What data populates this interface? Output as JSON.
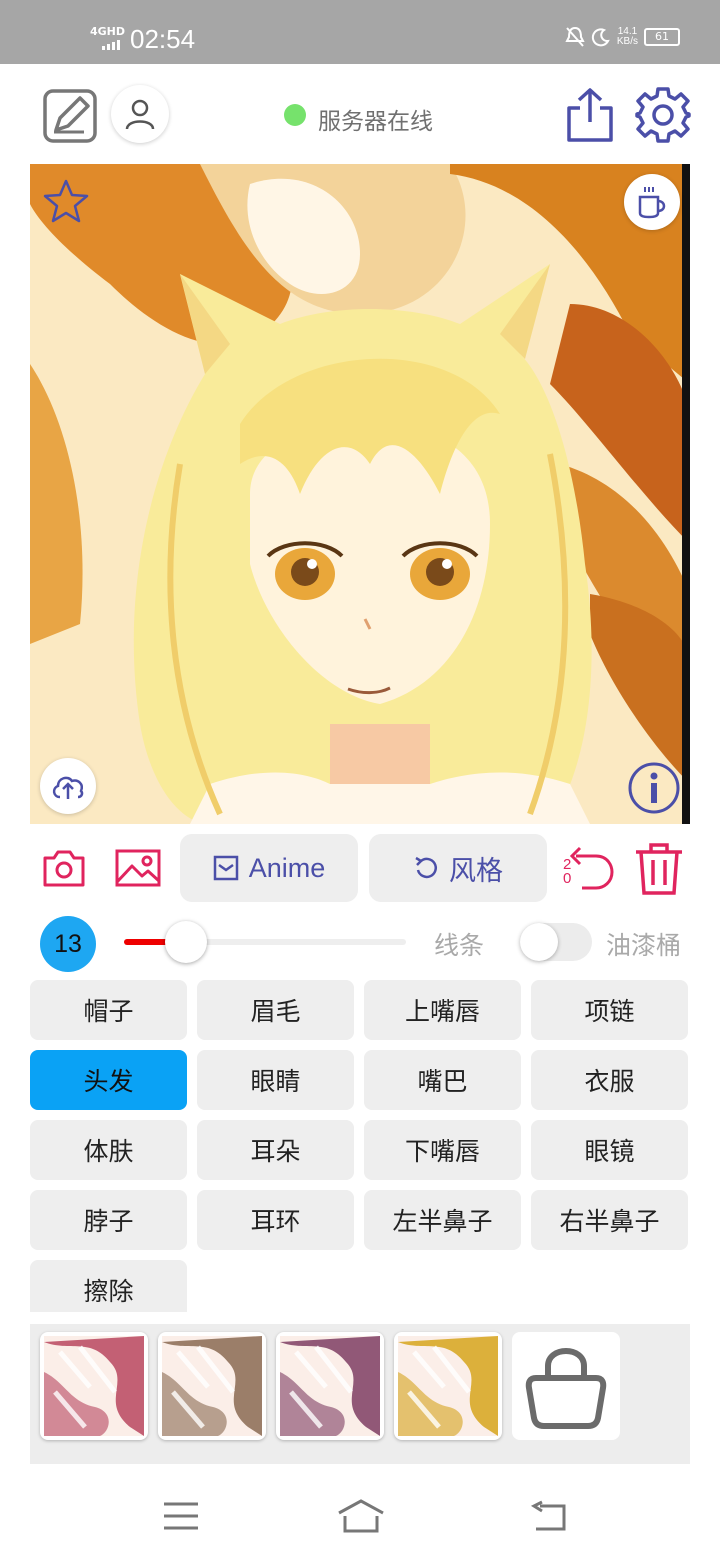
{
  "status_bar": {
    "network": "4GHD",
    "time": "02:54",
    "speed_value": "14.1",
    "speed_unit": "KB/s",
    "battery": "61"
  },
  "header": {
    "server_status": "服务器在线",
    "status_color": "#76e26c"
  },
  "tools": {
    "model_label": "Anime",
    "style_label": "风格",
    "undo_count_top": "2",
    "undo_count_bottom": "0"
  },
  "brush": {
    "size": "13",
    "size_fraction": 0.22,
    "line_label": "线条",
    "bucket_label": "油漆桶",
    "bucket_enabled": false
  },
  "parts": [
    {
      "label": "帽子",
      "active": false
    },
    {
      "label": "眉毛",
      "active": false
    },
    {
      "label": "上嘴唇",
      "active": false
    },
    {
      "label": "项链",
      "active": false
    },
    {
      "label": "头发",
      "active": true
    },
    {
      "label": "眼睛",
      "active": false
    },
    {
      "label": "嘴巴",
      "active": false
    },
    {
      "label": "衣服",
      "active": false
    },
    {
      "label": "体肤",
      "active": false
    },
    {
      "label": "耳朵",
      "active": false
    },
    {
      "label": "下嘴唇",
      "active": false
    },
    {
      "label": "眼镜",
      "active": false
    },
    {
      "label": "脖子",
      "active": false
    },
    {
      "label": "耳环",
      "active": false
    },
    {
      "label": "左半鼻子",
      "active": false
    },
    {
      "label": "右半鼻子",
      "active": false
    },
    {
      "label": "擦除",
      "active": false
    }
  ],
  "textures": [
    {
      "name": "pink-texture",
      "color": "#b8465f"
    },
    {
      "name": "brown-texture",
      "color": "#8a6a52"
    },
    {
      "name": "plum-texture",
      "color": "#7e3d63"
    },
    {
      "name": "gold-texture",
      "color": "#d6a41c"
    }
  ],
  "colors": {
    "accent_red": "#e0245e",
    "indigo": "#4b4fa8",
    "active_blue": "#0aa2f5"
  }
}
